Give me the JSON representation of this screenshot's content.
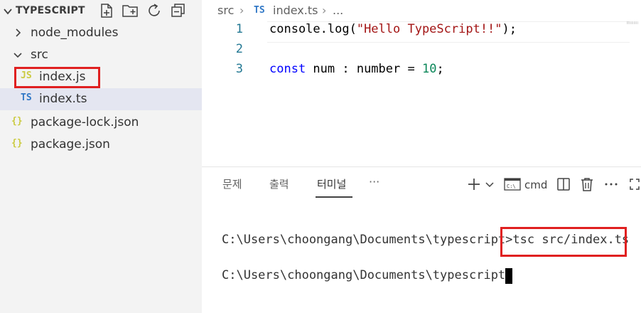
{
  "explorer": {
    "title": "TYPESCRIPT",
    "header_actions": [
      "new-file-icon",
      "new-folder-icon",
      "refresh-icon",
      "collapse-all-icon"
    ],
    "items": [
      {
        "label": "node_modules",
        "type": "folder",
        "expanded": false
      },
      {
        "label": "src",
        "type": "folder",
        "expanded": true
      },
      {
        "label": "index.js",
        "type": "file",
        "icon_text": "JS",
        "icon_color": "#cbcb41",
        "highlighted": true
      },
      {
        "label": "index.ts",
        "type": "file",
        "icon_text": "TS",
        "icon_color": "#3178c6",
        "selected": true
      },
      {
        "label": "package-lock.json",
        "type": "file",
        "icon_text": "{}",
        "icon_color": "#cbcb41"
      },
      {
        "label": "package.json",
        "type": "file",
        "icon_text": "{}",
        "icon_color": "#cbcb41"
      }
    ]
  },
  "breadcrumb": {
    "folder": "src",
    "file_icon": "TS",
    "file": "index.ts",
    "more": "..."
  },
  "editor": {
    "lines": [
      {
        "number": "1",
        "text": "console.log(\"Hello TypeScript!!\");"
      },
      {
        "number": "2",
        "text": ""
      },
      {
        "number": "3",
        "text": "const num : number = 10;"
      }
    ]
  },
  "panel": {
    "tabs": [
      {
        "label": "문제",
        "active": false
      },
      {
        "label": "출력",
        "active": false
      },
      {
        "label": "터미널",
        "active": true
      }
    ],
    "more": "···",
    "terminal_name": "cmd",
    "actions": [
      "add-icon",
      "chevron-down-icon",
      "terminal-cmd-icon",
      "split-icon",
      "trash-icon",
      "more-icon",
      "maximize-icon"
    ]
  },
  "terminal": {
    "lines": [
      {
        "prompt": "C:\\Users\\choongang\\Documents\\typescript>",
        "command": "tsc src/index.ts"
      },
      {
        "prompt": "C:\\Users\\choongang\\Documents\\typescript>",
        "command": ""
      }
    ]
  },
  "colors": {
    "highlight_box": "#e02020",
    "sidebar_bg": "#f3f3f3",
    "selected_row": "#e4e6f1",
    "line_number": "#237893",
    "keyword": "#0000ff",
    "string": "#a31515",
    "number": "#098658"
  }
}
